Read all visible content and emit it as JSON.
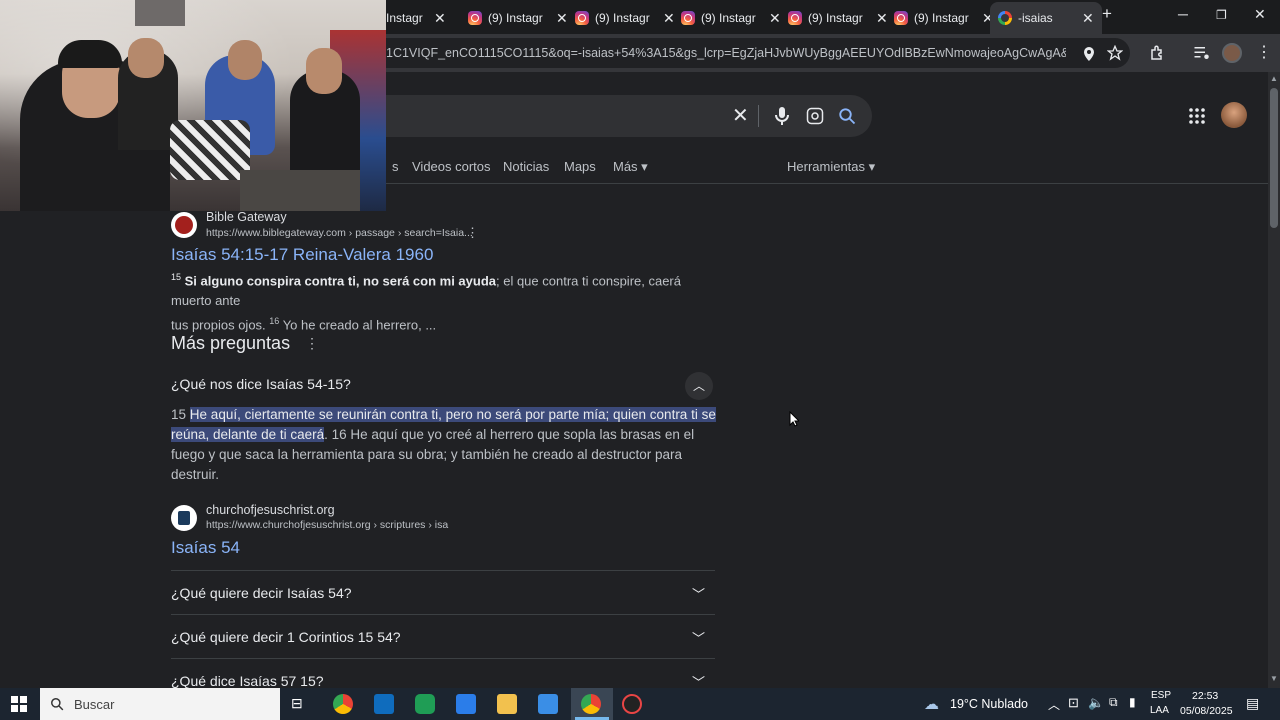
{
  "tabs": [
    {
      "label": "Instagr",
      "icon": "instagram-icon"
    },
    {
      "label": "(9) Instagr",
      "icon": "instagram-icon"
    },
    {
      "label": "(9) Instagr",
      "icon": "instagram-icon"
    },
    {
      "label": "(9) Instagr",
      "icon": "instagram-icon"
    },
    {
      "label": "(9) Instagr",
      "icon": "instagram-icon"
    },
    {
      "label": "(9) Instagr",
      "icon": "instagram-icon"
    },
    {
      "label": "-isaias",
      "icon": "google-icon",
      "active": true
    }
  ],
  "window": {
    "minimize": "─",
    "maximize": "❐",
    "close": "✕",
    "new_tab": "+"
  },
  "address": {
    "url": "1C1VIQF_enCO1115CO1115&oq=-isaias+54%3A15&gs_lcrp=EgZjaHJvbWUyBggAEEUYOdIBBzEwNmowajeoAgCwAgA&sourcei..."
  },
  "search": {
    "nav": [
      "Videos cortos",
      "Noticias",
      "Maps",
      "Más ▾"
    ],
    "tools": "Herramientas ▾"
  },
  "results": {
    "first": {
      "site": "Bible Gateway",
      "url": "https://www.biblegateway.com › passage › search=Isaia...",
      "title": "Isaías 54:15-17 Reina-Valera 1960",
      "snippet_sup1": "15",
      "snippet_bold": "Si alguno conspira contra ti, no será con mi ayuda",
      "snippet_rest": "; el que contra ti conspire, caerá muerto ante",
      "snippet_line2a": "tus propios ojos.",
      "snippet_sup2": "16",
      "snippet_line2b": "Yo he creado al herrero, ..."
    },
    "paa": {
      "heading": "Más preguntas",
      "expanded_question": "¿Qué nos dice Isaías 54-15?",
      "answer_num": "15",
      "answer_highlight_1": "He aquí, ciertamente se reunirán contra ti, pero no será por parte mía; quien contra ti se",
      "answer_highlight_2": "reúna, delante de ti caerá",
      "answer_rest_1": ". 16 He aquí que yo creé al herrero que sopla las brasas en el",
      "answer_line3": "fuego y que saca la herramienta para su obra; y también he creado al destructor para",
      "answer_line4": "destruir.",
      "source_site": "churchofjesuschrist.org",
      "source_url": "https://www.churchofjesuschrist.org › scriptures › isa",
      "source_title": "Isaías 54",
      "questions": [
        "¿Qué quiere decir Isaías 54?",
        "¿Qué quiere decir 1 Corintios 15 54?",
        "¿Qué dice Isaías 57 15?"
      ]
    }
  },
  "taskbar": {
    "search_placeholder": "Buscar",
    "weather": "19°C  Nublado",
    "lang1": "ESP",
    "lang2": "LAA",
    "time": "22:53",
    "date": "05/08/2025"
  }
}
